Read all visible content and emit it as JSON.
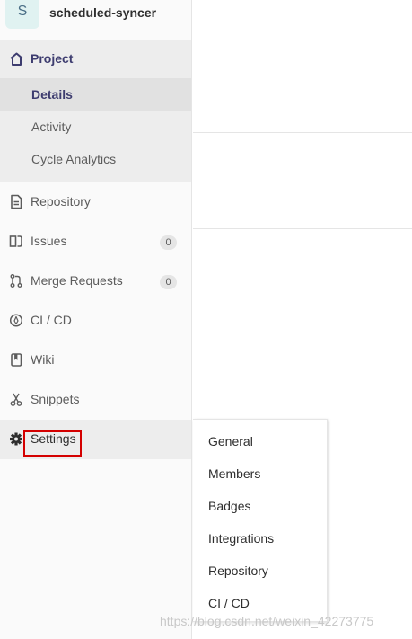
{
  "project": {
    "avatar_letter": "S",
    "name": "scheduled-syncer"
  },
  "sidebar": {
    "section": "Project",
    "sub_items": [
      {
        "label": "Details",
        "active": true
      },
      {
        "label": "Activity",
        "active": false
      },
      {
        "label": "Cycle Analytics",
        "active": false
      }
    ],
    "items": [
      {
        "label": "Repository",
        "icon": "document-icon"
      },
      {
        "label": "Issues",
        "icon": "issues-icon",
        "count": "0"
      },
      {
        "label": "Merge Requests",
        "icon": "merge-request-icon",
        "count": "0"
      },
      {
        "label": "CI / CD",
        "icon": "rocket-icon"
      },
      {
        "label": "Wiki",
        "icon": "book-icon"
      },
      {
        "label": "Snippets",
        "icon": "scissors-icon"
      },
      {
        "label": "Settings",
        "icon": "gear-icon"
      }
    ]
  },
  "settings_flyout": {
    "items": [
      "General",
      "Members",
      "Badges",
      "Integrations",
      "Repository",
      "CI / CD"
    ]
  },
  "watermark": "https://blog.csdn.net/weixin_42273775",
  "colors": {
    "highlight_box": "#d40000",
    "active_text": "#3d3c6f"
  }
}
